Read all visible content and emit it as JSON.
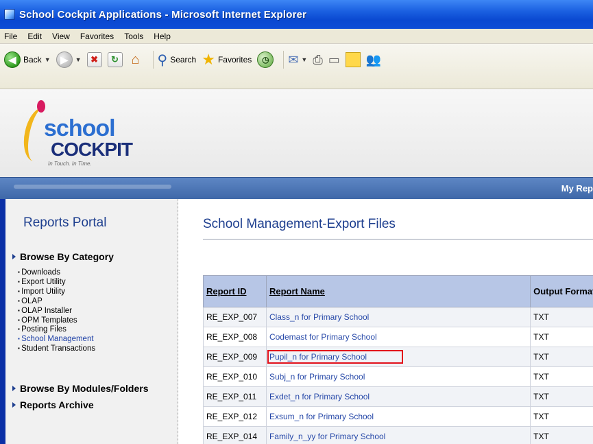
{
  "window": {
    "title": "School Cockpit Applications - Microsoft Internet Explorer"
  },
  "menu": [
    "File",
    "Edit",
    "View",
    "Favorites",
    "Tools",
    "Help"
  ],
  "toolbar": {
    "back_label": "Back",
    "search_label": "Search",
    "favorites_label": "Favorites"
  },
  "logo": {
    "line1": "school",
    "line2": "COCKPIT",
    "tagline": "In Touch. In Time."
  },
  "nav": {
    "my_reports": "My Rep"
  },
  "sidebar": {
    "title": "Reports Portal",
    "browse_category": "Browse By Category",
    "categories": [
      "Downloads",
      "Export Utility",
      "Import Utility",
      "OLAP",
      "OLAP Installer",
      "OPM Templates",
      "Posting Files",
      "School Management",
      "Student Transactions"
    ],
    "browse_modules": "Browse By Modules/Folders",
    "reports_archive": "Reports Archive"
  },
  "main": {
    "title": "School Management-Export Files",
    "table": {
      "headers": [
        "Report ID",
        "Report Name",
        "Output Format"
      ],
      "rows": [
        {
          "id": "RE_EXP_007",
          "name": "Class_n for Primary School",
          "format": "TXT"
        },
        {
          "id": "RE_EXP_008",
          "name": "Codemast for Primary School",
          "format": "TXT"
        },
        {
          "id": "RE_EXP_009",
          "name": "Pupil_n for Primary School",
          "format": "TXT"
        },
        {
          "id": "RE_EXP_010",
          "name": "Subj_n for Primary School",
          "format": "TXT"
        },
        {
          "id": "RE_EXP_011",
          "name": "Exdet_n for Primary School",
          "format": "TXT"
        },
        {
          "id": "RE_EXP_012",
          "name": "Exsum_n for Primary School",
          "format": "TXT"
        },
        {
          "id": "RE_EXP_014",
          "name": "Family_n_yy for Primary School",
          "format": "TXT"
        }
      ]
    }
  },
  "colors": {
    "accent": "#1e3f8f",
    "link": "#2648a8",
    "highlight": "#e2111b"
  }
}
